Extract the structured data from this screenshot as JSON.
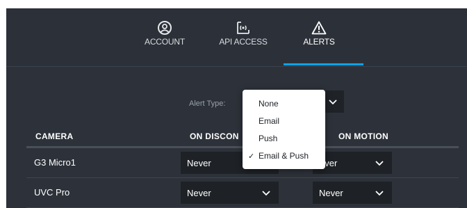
{
  "nav": {
    "tabs": [
      {
        "label": "ACCOUNT",
        "icon": "user-circle-icon",
        "active": false
      },
      {
        "label": "API ACCESS",
        "icon": "broadcast-icon",
        "active": false
      },
      {
        "label": "ALERTS",
        "icon": "warning-triangle-icon",
        "active": true
      }
    ],
    "accent_color": "#0ea2e5"
  },
  "alert_type": {
    "label": "Alert Type:",
    "options": [
      "None",
      "Email",
      "Push",
      "Email & Push"
    ],
    "selected": "Email & Push",
    "check_mark": "✓"
  },
  "table": {
    "columns": [
      "CAMERA",
      "ON DISCON",
      "ON MOTION"
    ],
    "rows": [
      {
        "camera": "G3 Micro1",
        "on_disconnect": "Never",
        "on_motion": "ever"
      },
      {
        "camera": "UVC Pro",
        "on_disconnect": "Never",
        "on_motion": "Never"
      }
    ]
  }
}
